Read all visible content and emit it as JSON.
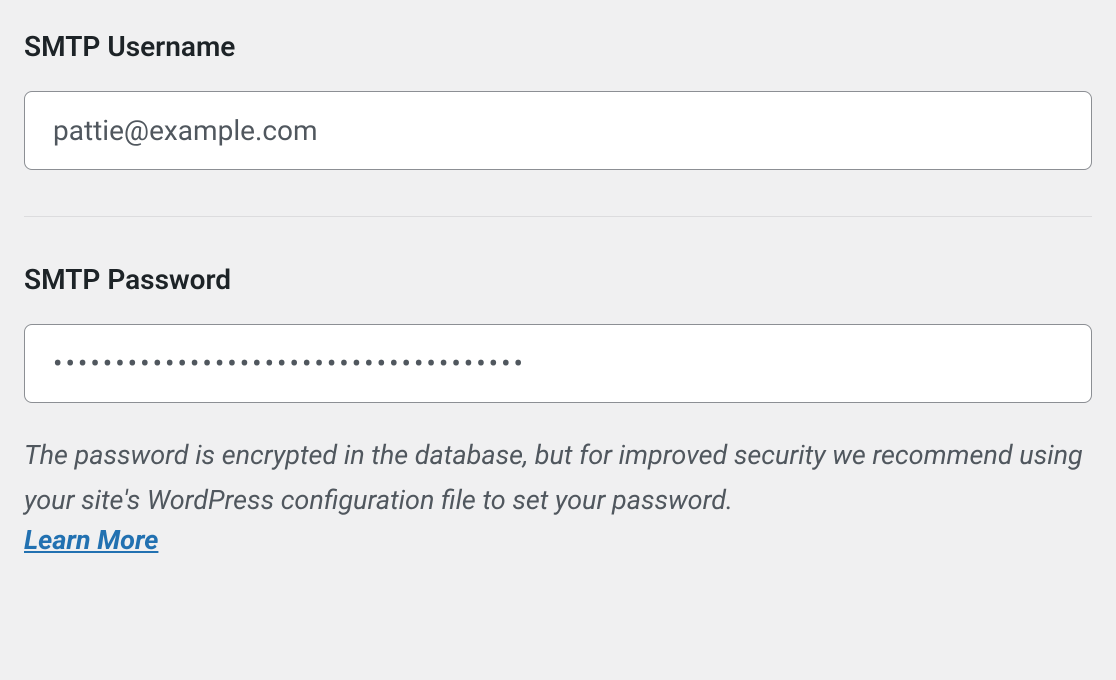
{
  "smtp": {
    "username": {
      "label": "SMTP Username",
      "value": "pattie@example.com"
    },
    "password": {
      "label": "SMTP Password",
      "value": "••••••••••••••••••••••••••••••••••••••",
      "help_text": "The password is encrypted in the database, but for improved security we recommend using your site's WordPress configuration file to set your password.",
      "learn_more_label": "Learn More"
    }
  }
}
